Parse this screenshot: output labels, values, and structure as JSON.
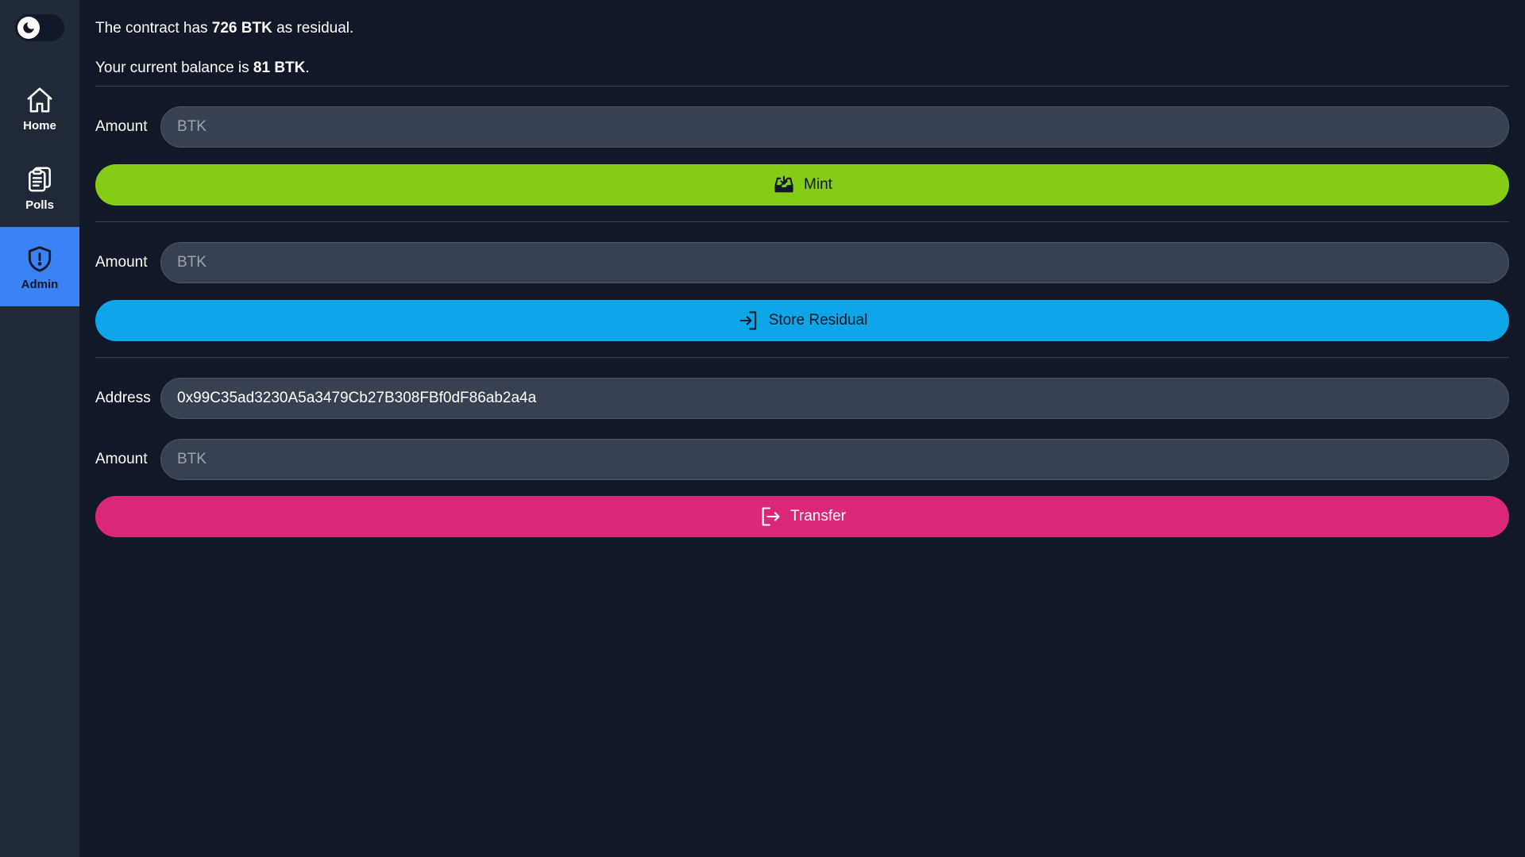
{
  "colors": {
    "background": "#111827",
    "sidebar": "#1f2937",
    "active_nav": "#3b82f6",
    "field": "#374151",
    "mint": "#84cc16",
    "store_residual": "#0ea5e9",
    "transfer": "#db2777"
  },
  "theme_toggle": {
    "icon": "moon-icon",
    "state": "dark"
  },
  "sidebar": {
    "items": [
      {
        "label": "Home",
        "icon": "home-icon",
        "active": false
      },
      {
        "label": "Polls",
        "icon": "clipboard-icon",
        "active": false
      },
      {
        "label": "Admin",
        "icon": "shield-alert-icon",
        "active": true
      }
    ]
  },
  "info": {
    "residual_prefix": "The contract has ",
    "residual_value": "726 BTK",
    "residual_suffix": " as residual.",
    "balance_prefix": "Your current balance is ",
    "balance_value": "81 BTK",
    "balance_suffix": "."
  },
  "mint": {
    "amount_label": "Amount",
    "amount_placeholder": "BTK",
    "amount_value": "",
    "button_label": "Mint",
    "button_icon": "inbox-download-icon"
  },
  "store": {
    "amount_label": "Amount",
    "amount_placeholder": "BTK",
    "amount_value": "",
    "button_label": "Store Residual",
    "button_icon": "login-icon"
  },
  "transfer": {
    "address_label": "Address",
    "address_value": "0x99C35ad3230A5a3479Cb27B308FBf0dF86ab2a4a",
    "amount_label": "Amount",
    "amount_placeholder": "BTK",
    "amount_value": "",
    "button_label": "Transfer",
    "button_icon": "logout-icon"
  }
}
